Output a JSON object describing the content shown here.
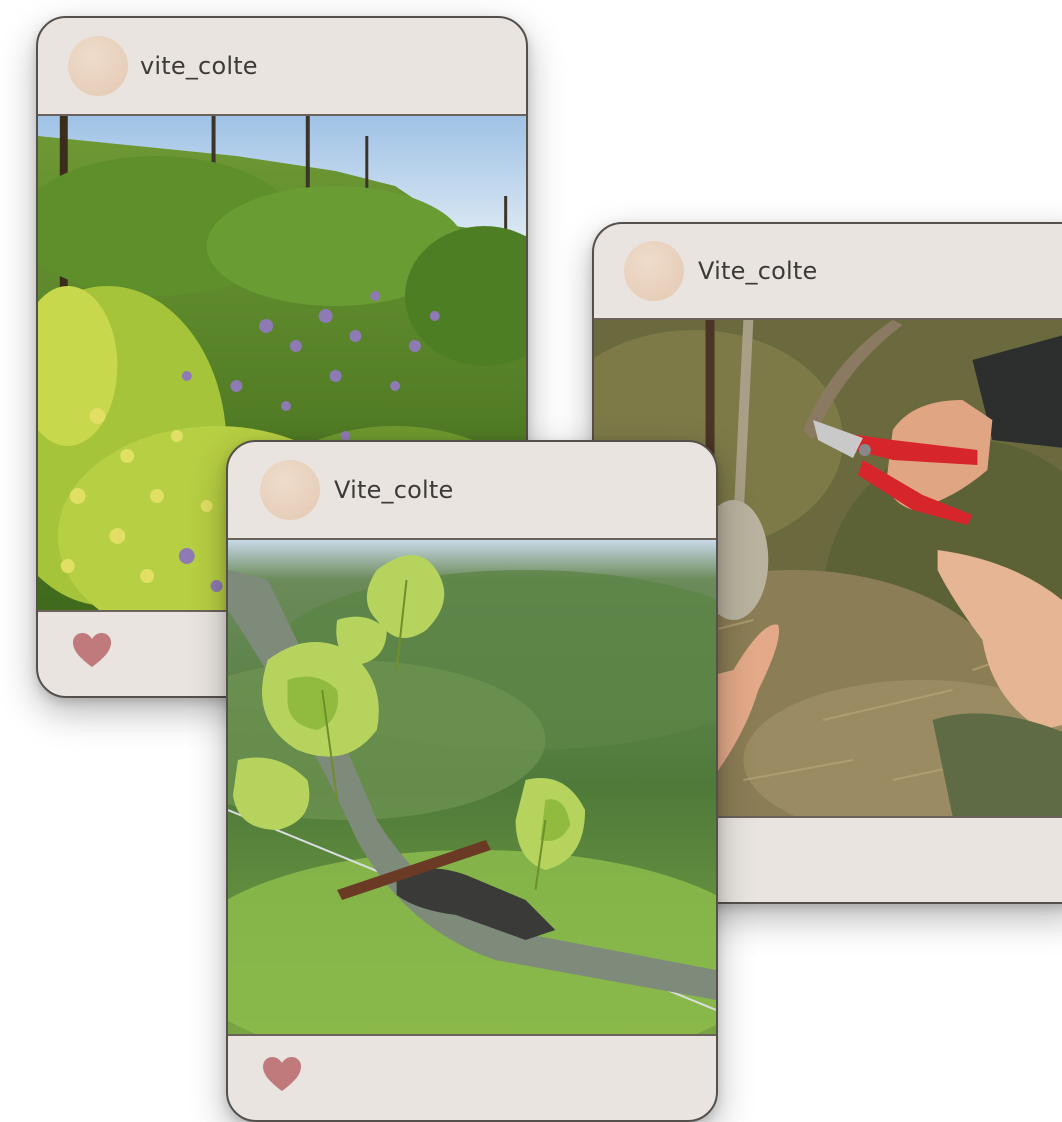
{
  "posts": [
    {
      "username": "vite_colte",
      "photo_icon": "vineyard-flowers-photo",
      "like_icon": "heart-icon",
      "like_color": "#c07a7c"
    },
    {
      "username": "Vite_colte",
      "photo_icon": "vine-leaves-photo",
      "like_icon": "heart-icon",
      "like_color": "#c07a7c"
    },
    {
      "username": "Vite_colte",
      "photo_icon": "pruning-shears-photo",
      "like_icon": "heart-icon",
      "like_color": "#c07a7c"
    }
  ],
  "colors": {
    "card_background": "#e9e4df",
    "card_border": "#55504c",
    "avatar": "#e6cfbc",
    "text": "#3e3a37"
  }
}
